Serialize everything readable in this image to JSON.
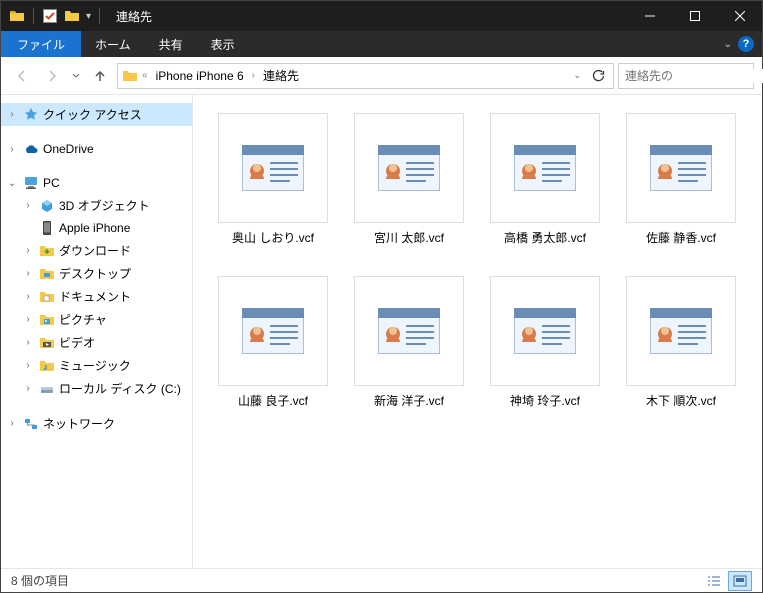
{
  "window": {
    "title": "連絡先"
  },
  "ribbon": {
    "file": "ファイル",
    "tabs": [
      "ホーム",
      "共有",
      "表示"
    ]
  },
  "address": {
    "crumbs": [
      "iPhone iPhone 6",
      "連絡先"
    ]
  },
  "search": {
    "placeholder": "連絡先の"
  },
  "nav": {
    "quick_access": "クイック アクセス",
    "onedrive": "OneDrive",
    "pc": "PC",
    "pc_children": [
      "3D オブジェクト",
      "Apple iPhone",
      "ダウンロード",
      "デスクトップ",
      "ドキュメント",
      "ピクチャ",
      "ビデオ",
      "ミュージック",
      "ローカル ディスク (C:)"
    ],
    "network": "ネットワーク"
  },
  "files": [
    "奥山 しおり.vcf",
    "宮川 太郎.vcf",
    "高橋 勇太郎.vcf",
    "佐藤 静香.vcf",
    "山藤 良子.vcf",
    "新海 洋子.vcf",
    "神埼 玲子.vcf",
    "木下 順次.vcf"
  ],
  "status": {
    "text": "8 個の項目"
  }
}
